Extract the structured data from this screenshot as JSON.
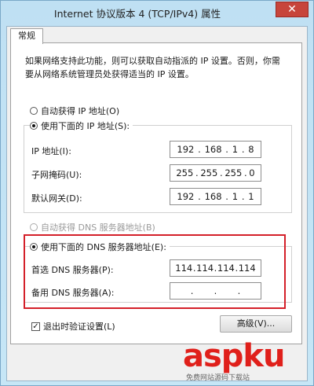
{
  "window": {
    "title": "Internet 协议版本 4 (TCP/IPv4) 属性",
    "close_glyph": "✕"
  },
  "tab": {
    "label": "常规"
  },
  "description": "如果网络支持此功能，则可以获取自动指派的 IP 设置。否则，你需要从网络系统管理员处获得适当的 IP 设置。",
  "ip": {
    "auto_label": "自动获得 IP 地址(O)",
    "manual_label": "使用下面的 IP 地址(S):",
    "address_label": "IP 地址(I):",
    "address": [
      "192",
      "168",
      "1",
      "8"
    ],
    "mask_label": "子网掩码(U):",
    "mask": [
      "255",
      "255",
      "255",
      "0"
    ],
    "gateway_label": "默认网关(D):",
    "gateway": [
      "192",
      "168",
      "1",
      "1"
    ]
  },
  "dns": {
    "auto_label": "自动获得 DNS 服务器地址(B)",
    "manual_label": "使用下面的 DNS 服务器地址(E):",
    "preferred_label": "首选 DNS 服务器(P):",
    "preferred": [
      "114",
      "114",
      "114",
      "114"
    ],
    "alternate_label": "备用 DNS 服务器(A):",
    "alternate": [
      "",
      "",
      "",
      ""
    ]
  },
  "validate_label": "退出时验证设置(L)",
  "advanced_label": "高级(V)...",
  "watermark": {
    "logo": "aspku",
    "sub": "免费网站源码下载站"
  },
  "colors": {
    "highlight": "#d4202a",
    "titlebar": "#bfe0f3",
    "close": "#c7453b"
  },
  "icons": {
    "close": "close-icon",
    "radio": "radio-icon",
    "checkbox": "checkbox-icon"
  }
}
